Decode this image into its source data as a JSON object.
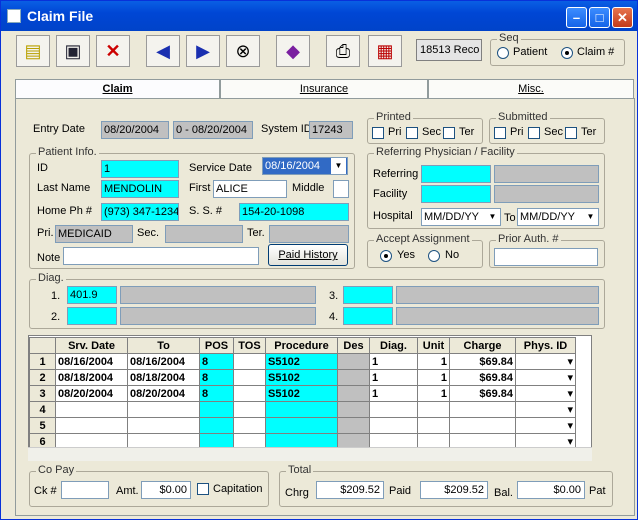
{
  "window": {
    "title": "Claim File"
  },
  "toolbar": {
    "record": "18513 Reco",
    "seq_label": "Seq",
    "seq_patient": "Patient",
    "seq_claim": "Claim #"
  },
  "tabs": [
    "Claim",
    "Insurance",
    "Misc."
  ],
  "entry": {
    "label": "Entry Date",
    "date": "08/20/2004",
    "range": "0 - 08/20/2004",
    "sysid_label": "System ID",
    "sysid": "17243"
  },
  "printed": {
    "label": "Printed",
    "pri": "Pri",
    "sec": "Sec",
    "ter": "Ter"
  },
  "submitted": {
    "label": "Submitted",
    "pri": "Pri",
    "sec": "Sec",
    "ter": "Ter"
  },
  "patient": {
    "group": "Patient Info.",
    "id_label": "ID",
    "id": "1",
    "svc_label": "Service Date",
    "svc": "08/16/2004",
    "last_label": "Last Name",
    "last": "MENDOLIN",
    "first_label": "First",
    "first": "ALICE",
    "middle_label": "Middle",
    "middle": "",
    "home_label": "Home Ph #",
    "home": "(973) 347-1234",
    "ss_label": "S. S. #",
    "ss": "154-20-1098",
    "pri_label": "Pri.",
    "pri": "MEDICAID",
    "sec_label": "Sec.",
    "ter_label": "Ter.",
    "note_label": "Note",
    "history_btn": "Paid History"
  },
  "referring": {
    "group": "Referring Physician / Facility",
    "ref_label": "Referring",
    "fac_label": "Facility",
    "hosp_label": "Hospital",
    "from": "MM/DD/YY",
    "to_label": "To",
    "to": "MM/DD/YY"
  },
  "accept": {
    "group": "Accept Assignment",
    "yes": "Yes",
    "no": "No"
  },
  "prior": {
    "group": "Prior Auth. #"
  },
  "diag": {
    "group": "Diag.",
    "n1": "1.",
    "v1": "401.9",
    "n2": "2.",
    "n3": "3.",
    "n4": "4."
  },
  "grid": {
    "headers": [
      "Srv. Date",
      "To",
      "POS",
      "TOS",
      "Procedure",
      "Des",
      "Diag.",
      "Unit",
      "Charge",
      "Phys. ID"
    ],
    "rows": [
      {
        "n": "1",
        "srv": "08/16/2004",
        "to": "08/16/2004",
        "pos": "8",
        "tos": "",
        "proc": "S5102",
        "des": "",
        "diag": "1",
        "unit": "1",
        "charge": "$69.84"
      },
      {
        "n": "2",
        "srv": "08/18/2004",
        "to": "08/18/2004",
        "pos": "8",
        "tos": "",
        "proc": "S5102",
        "des": "",
        "diag": "1",
        "unit": "1",
        "charge": "$69.84"
      },
      {
        "n": "3",
        "srv": "08/20/2004",
        "to": "08/20/2004",
        "pos": "8",
        "tos": "",
        "proc": "S5102",
        "des": "",
        "diag": "1",
        "unit": "1",
        "charge": "$69.84"
      },
      {
        "n": "4",
        "srv": "",
        "to": "",
        "pos": "",
        "tos": "",
        "proc": "",
        "des": "",
        "diag": "",
        "unit": "",
        "charge": ""
      },
      {
        "n": "5",
        "srv": "",
        "to": "",
        "pos": "",
        "tos": "",
        "proc": "",
        "des": "",
        "diag": "",
        "unit": "",
        "charge": ""
      },
      {
        "n": "6",
        "srv": "",
        "to": "",
        "pos": "",
        "tos": "",
        "proc": "",
        "des": "",
        "diag": "",
        "unit": "",
        "charge": ""
      }
    ]
  },
  "copay": {
    "group": "Co Pay",
    "ck_label": "Ck #",
    "amt_label": "Amt.",
    "amt": "$0.00",
    "cap_label": "Capitation"
  },
  "total": {
    "group": "Total",
    "chrg_label": "Chrg",
    "chrg": "$209.52",
    "paid_label": "Paid",
    "paid": "$209.52",
    "bal_label": "Bal.",
    "bal": "$0.00",
    "pat_label": "Pat"
  },
  "colors": {
    "highlight": "#00ffff",
    "title": "#0046d5"
  }
}
